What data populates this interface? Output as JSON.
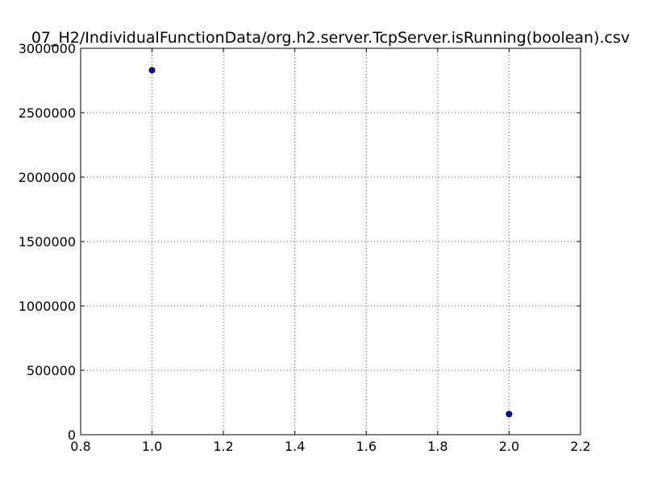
{
  "chart_data": {
    "type": "scatter",
    "title": "07_H2/IndividualFunctionData/org.h2.server.TcpServer.isRunning(boolean).csv",
    "xlabel": "",
    "ylabel": "",
    "xlim": [
      0.8,
      2.2
    ],
    "ylim": [
      0,
      3000000
    ],
    "xticks": [
      "0.8",
      "1.0",
      "1.2",
      "1.4",
      "1.6",
      "1.8",
      "2.0",
      "2.2"
    ],
    "yticks": [
      "0",
      "500000",
      "1000000",
      "1500000",
      "2000000",
      "2500000",
      "3000000"
    ],
    "grid": true,
    "series": [
      {
        "points": [
          {
            "x": 1.0,
            "y": 2830000
          },
          {
            "x": 2.0,
            "y": 160000
          }
        ]
      }
    ],
    "colors": {
      "marker_fill": "#0000aa",
      "marker_edge": "#000000",
      "grid": "#555555",
      "axes": "#000000"
    }
  }
}
